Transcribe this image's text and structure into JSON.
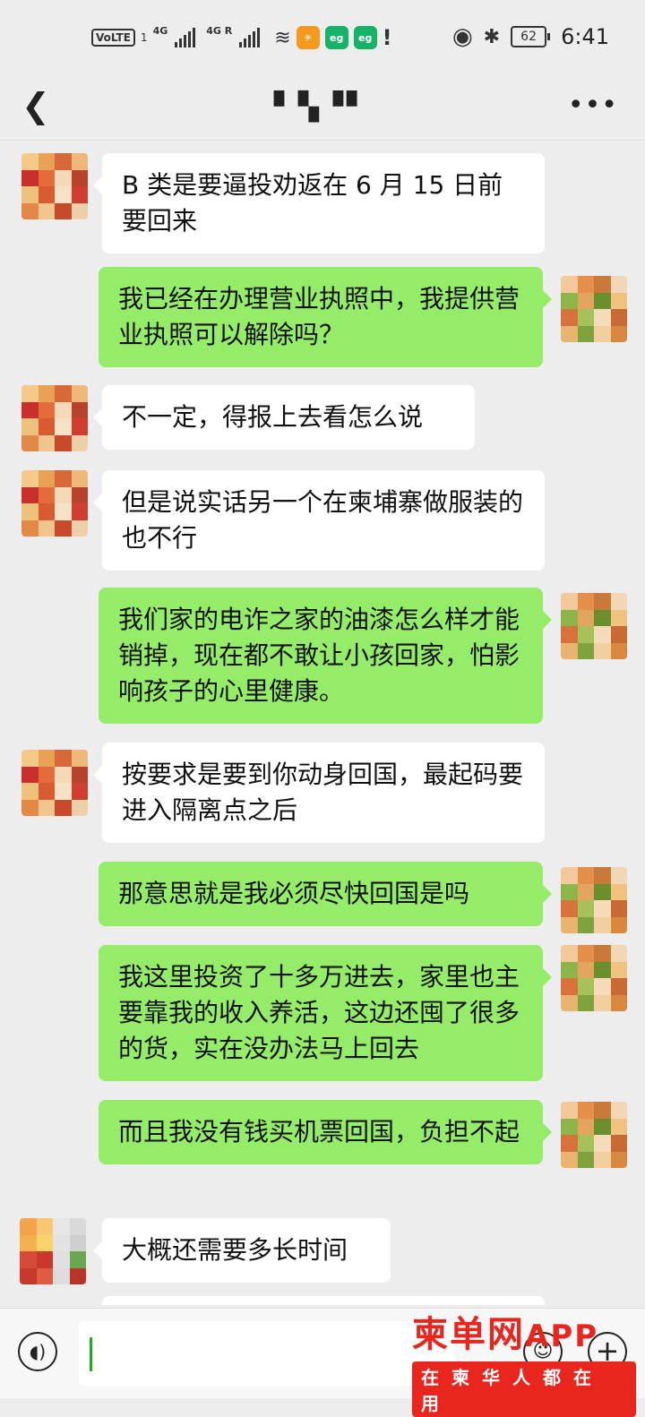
{
  "status_bar": {
    "volte": "VoLTE",
    "sim1": "1",
    "net1": "4G",
    "net2": "4G R",
    "time": "6:41",
    "battery": "62",
    "app_icons": [
      {
        "name": "orange-app-icon",
        "color": "#f39a1e"
      },
      {
        "name": "green-app-icon-1",
        "color": "#17b36b"
      },
      {
        "name": "green-app-icon-2",
        "color": "#17b36b"
      }
    ]
  },
  "header": {
    "title": "▘▚▝▘"
  },
  "messages": [
    {
      "side": "in",
      "text": "B 类是要逼投劝返在 6 月 15 日前要回来"
    },
    {
      "side": "out",
      "text": "我已经在办理营业执照中，我提供营业执照可以解除吗？"
    },
    {
      "side": "in",
      "text": "不一定，得报上去看怎么说"
    },
    {
      "side": "in",
      "text": "但是说实话另一个在柬埔寨做服装的也不行"
    },
    {
      "side": "out",
      "text": "我们家的电诈之家的油漆怎么样才能销掉，现在都不敢让小孩回家，怕影响孩子的心里健康。"
    },
    {
      "side": "in",
      "text": "按要求是要到你动身回国，最起码要进入隔离点之后"
    },
    {
      "side": "out",
      "text": "那意思就是我必须尽快回国是吗"
    },
    {
      "side": "out",
      "text": "我这里投资了十多万进去，家里也主要靠我的收入养活，这边还囤了很多的货，实在没办法马上回去"
    },
    {
      "side": "out",
      "text": "而且我没有钱买机票回国，负担不起"
    },
    {
      "side": "in",
      "text": "大概还需要多长时间"
    }
  ],
  "input": {
    "value": ""
  },
  "watermark": {
    "top": "柬单网",
    "app": "APP",
    "bottom": "在柬华人都在用"
  },
  "colors": {
    "incoming_bubble": "#ffffff",
    "outgoing_bubble": "#95ec69",
    "background": "#ededed",
    "watermark": "#e8261e"
  }
}
